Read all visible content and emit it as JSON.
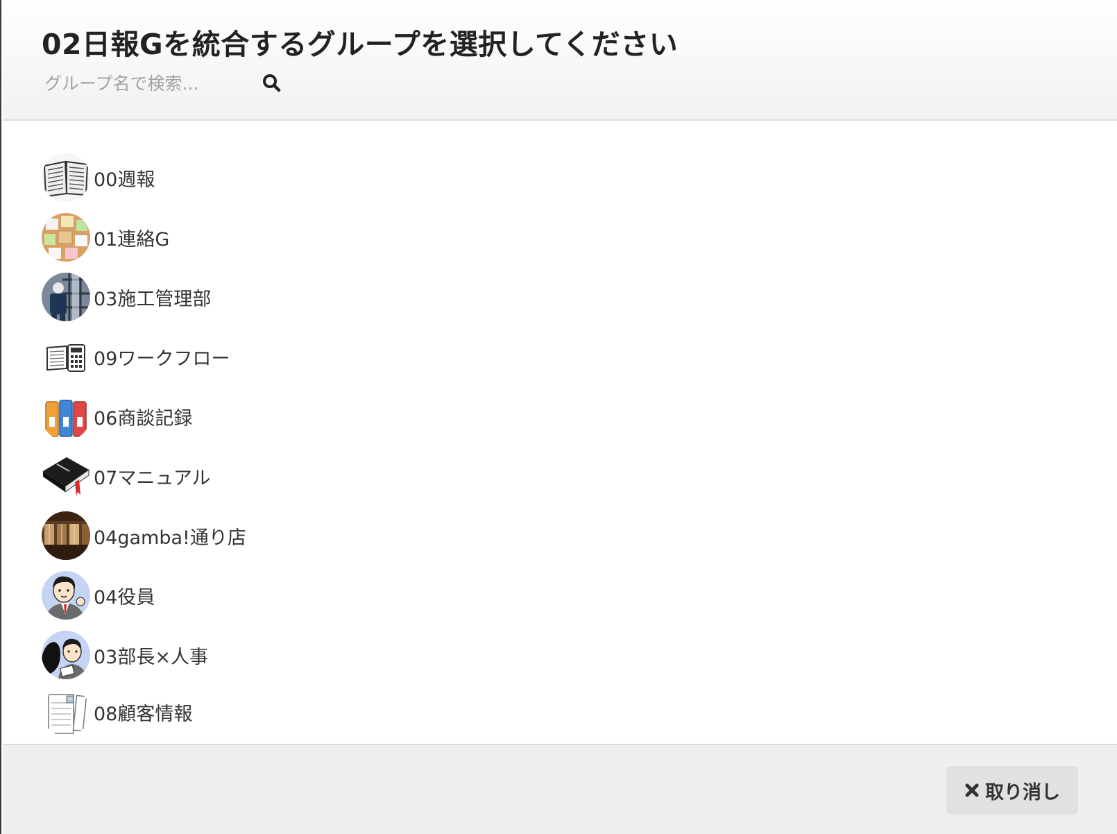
{
  "dialog": {
    "title": "02日報Gを統合するグループを選択してください",
    "search": {
      "placeholder": "グループ名で検索...",
      "value": ""
    }
  },
  "groups": [
    {
      "label": "00週報",
      "icon": "open-book-icon"
    },
    {
      "label": "01連絡G",
      "icon": "sticky-notes-icon"
    },
    {
      "label": "03施工管理部",
      "icon": "construction-worker-icon"
    },
    {
      "label": "09ワークフロー",
      "icon": "book-calculator-icon"
    },
    {
      "label": "06商談記録",
      "icon": "binders-icon"
    },
    {
      "label": "07マニュアル",
      "icon": "manual-book-icon"
    },
    {
      "label": "04gamba!通り店",
      "icon": "shop-interior-icon"
    },
    {
      "label": "04役員",
      "icon": "businessman-thumbs-up-icon"
    },
    {
      "label": "03部長×人事",
      "icon": "manager-hr-icon"
    },
    {
      "label": "08顧客情報",
      "icon": "customer-documents-icon"
    }
  ],
  "footer": {
    "cancel_label": "取り消し"
  }
}
